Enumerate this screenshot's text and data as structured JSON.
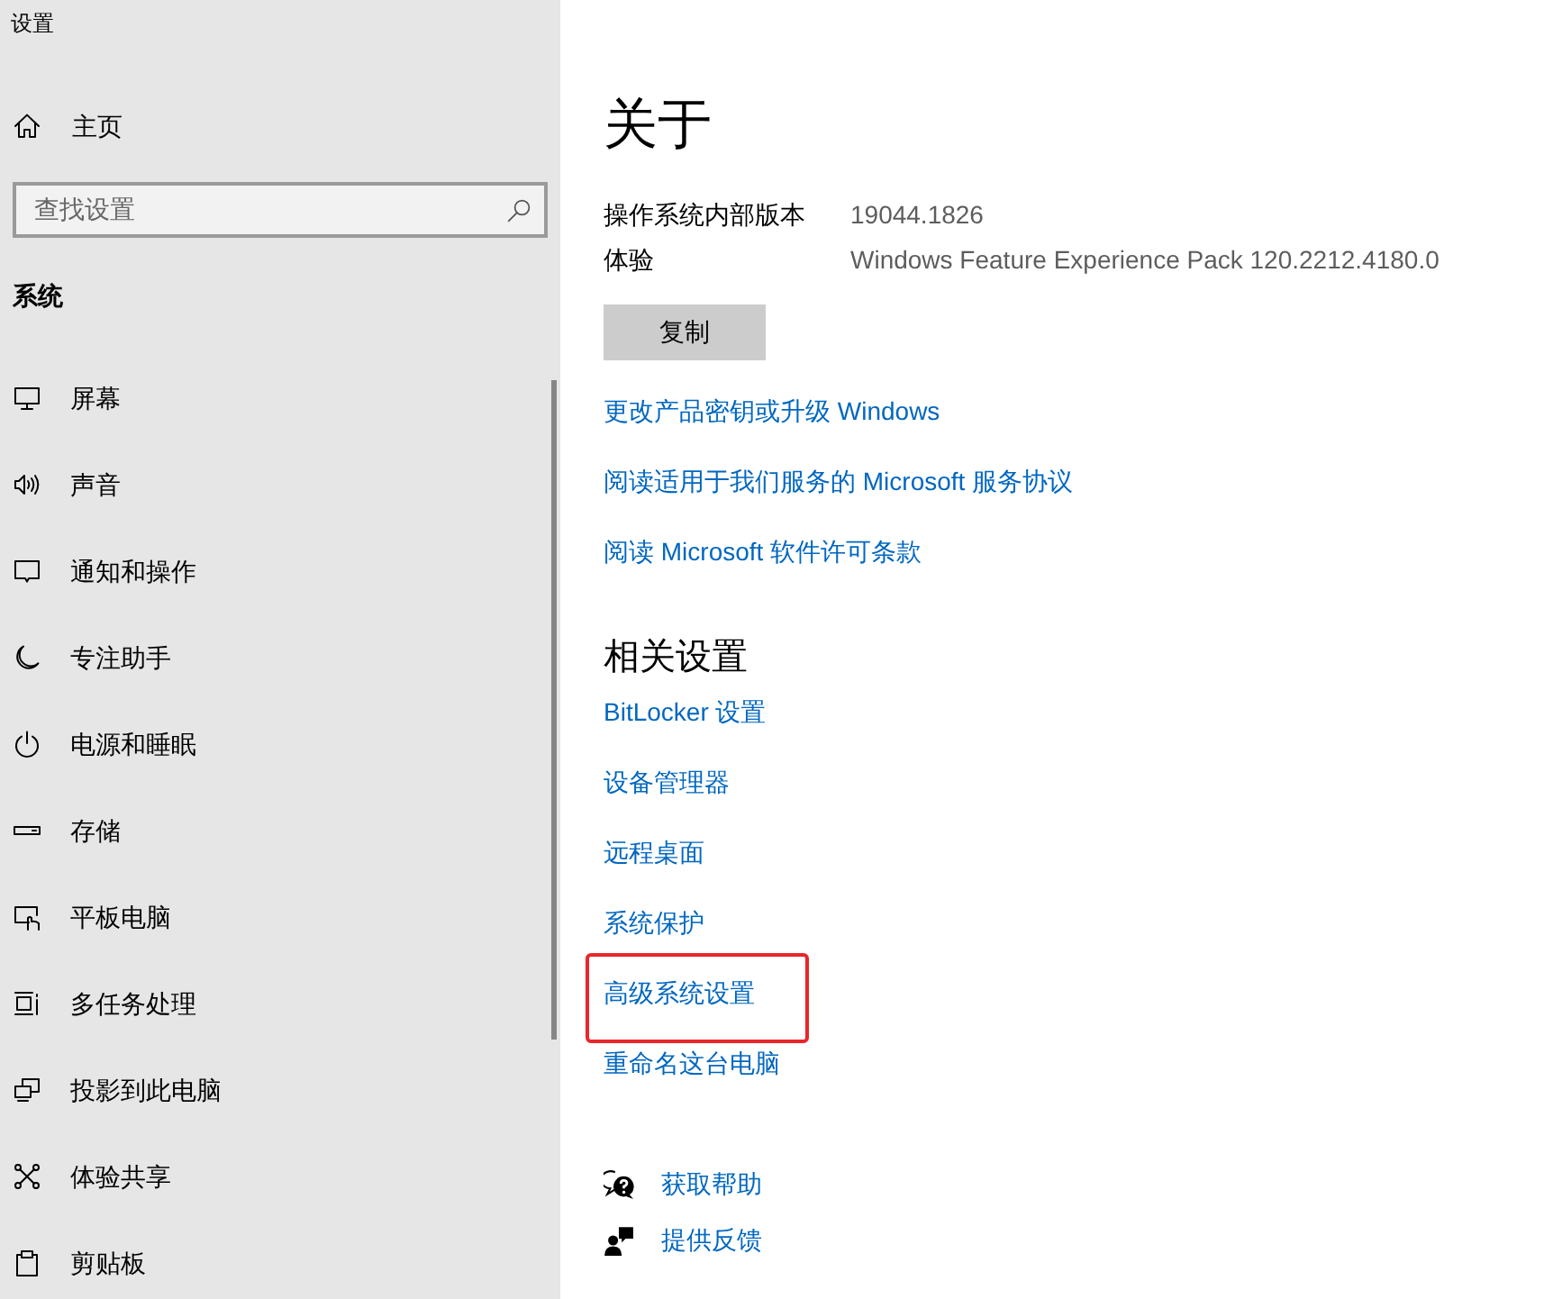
{
  "window": {
    "title": "设置"
  },
  "sidebar": {
    "home": {
      "label": "主页"
    },
    "search": {
      "placeholder": "查找设置"
    },
    "section_title": "系统",
    "items": [
      {
        "label": "屏幕",
        "selected": false
      },
      {
        "label": "声音",
        "selected": false
      },
      {
        "label": "通知和操作",
        "selected": false
      },
      {
        "label": "专注助手",
        "selected": false
      },
      {
        "label": "电源和睡眠",
        "selected": false
      },
      {
        "label": "存储",
        "selected": false
      },
      {
        "label": "平板电脑",
        "selected": false
      },
      {
        "label": "多任务处理",
        "selected": false
      },
      {
        "label": "投影到此电脑",
        "selected": false
      },
      {
        "label": "体验共享",
        "selected": false
      },
      {
        "label": "剪贴板",
        "selected": false
      }
    ]
  },
  "main": {
    "title": "关于",
    "specs": [
      {
        "label": "操作系统内部版本",
        "value": "19044.1826"
      },
      {
        "label": "体验",
        "value": "Windows Feature Experience Pack 120.2212.4180.0"
      }
    ],
    "copy_button": "复制",
    "links": [
      "更改产品密钥或升级 Windows",
      "阅读适用于我们服务的 Microsoft 服务协议",
      "阅读 Microsoft 软件许可条款"
    ],
    "related": {
      "title": "相关设置",
      "links": [
        {
          "label": "BitLocker 设置",
          "highlighted": false
        },
        {
          "label": "设备管理器",
          "highlighted": false
        },
        {
          "label": "远程桌面",
          "highlighted": false
        },
        {
          "label": "系统保护",
          "highlighted": false
        },
        {
          "label": "高级系统设置",
          "highlighted": true
        },
        {
          "label": "重命名这台电脑",
          "highlighted": false
        }
      ]
    },
    "help_links": [
      "获取帮助",
      "提供反馈"
    ]
  }
}
